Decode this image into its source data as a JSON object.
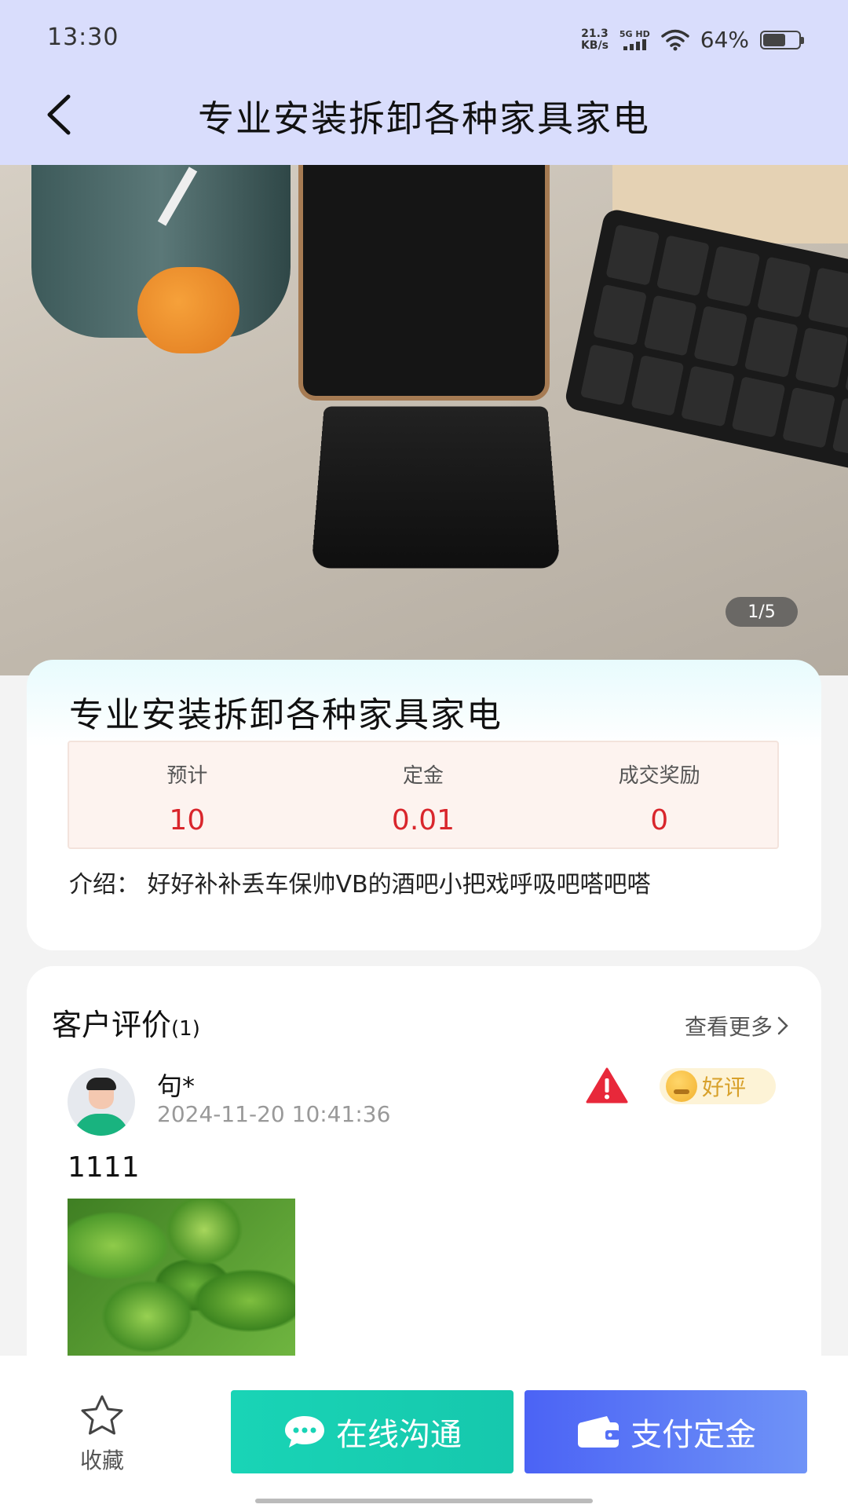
{
  "status_bar": {
    "time": "13:30",
    "net_speed_value": "21.3",
    "net_speed_unit": "KB/s",
    "signal_label": "5G HD",
    "battery_percent": "64%",
    "battery_level": 0.64
  },
  "header": {
    "title": "专业安装拆卸各种家具家电"
  },
  "gallery": {
    "page_indicator": "1/5"
  },
  "info": {
    "title": "专业安装拆卸各种家具家电",
    "stats": [
      {
        "label": "预计",
        "value": "10"
      },
      {
        "label": "定金",
        "value": "0.01"
      },
      {
        "label": "成交奖励",
        "value": "0"
      }
    ],
    "intro": "介绍： 好好补补丢车保帅VB的酒吧小把戏呼吸吧嗒吧嗒"
  },
  "reviews": {
    "heading": "客户评价",
    "count": "(1)",
    "more_label": "查看更多",
    "items": [
      {
        "name": "句*",
        "time": "2024-11-20 10:41:36",
        "badge": "好评",
        "text": "1111"
      }
    ]
  },
  "bottom_bar": {
    "favorite_label": "收藏",
    "chat_label": "在线沟通",
    "pay_label": "支付定金"
  },
  "colors": {
    "header_bg": "#d9ddfc",
    "stat_value": "#d9262c",
    "chat_button": "#19d4b6",
    "pay_button": "#4b63f5",
    "badge_text": "#d8a12b"
  },
  "icons": [
    "back-arrow-icon",
    "wifi-icon",
    "battery-icon",
    "chevron-right-icon",
    "warning-icon",
    "smile-emoji-icon",
    "star-icon",
    "chat-bubble-icon",
    "wallet-icon"
  ]
}
